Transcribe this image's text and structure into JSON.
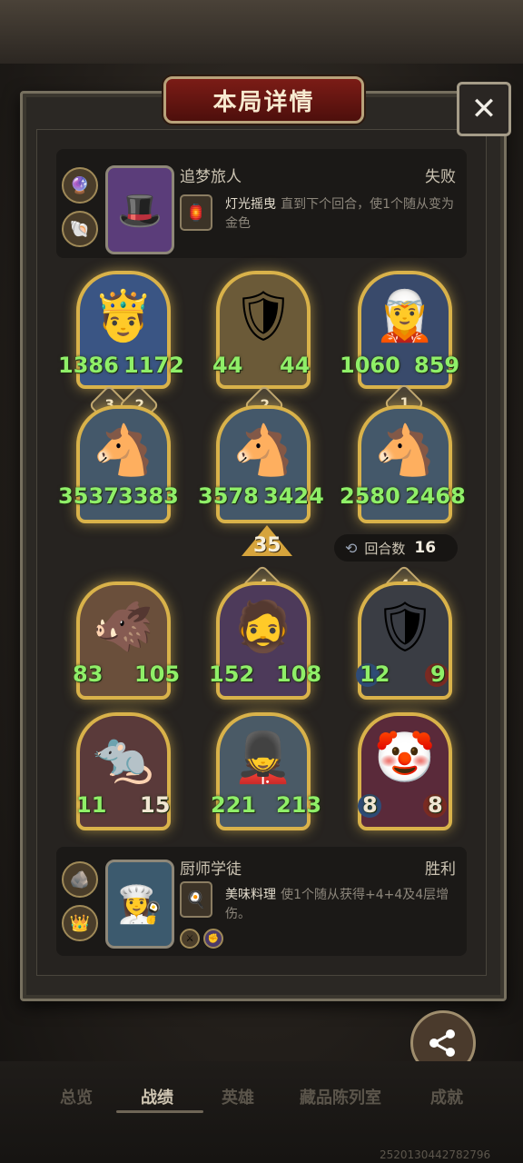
{
  "title": "本局详情",
  "close_icon": "close-icon",
  "opponent": {
    "name": "追梦旅人",
    "result": "失败",
    "skill_name": "灯光摇曳",
    "skill_desc": "直到下个回合，使1个随从变为金色"
  },
  "player": {
    "name": "厨师学徒",
    "result": "胜利",
    "skill_name": "美味料理",
    "skill_desc": "使1个随从获得+4+4及4层增伤。"
  },
  "opponent_units": [
    {
      "attack": "1386",
      "health": "1172",
      "stars": ""
    },
    {
      "attack": "44",
      "health": "44",
      "stars": ""
    },
    {
      "attack": "1060",
      "health": "859",
      "stars": ""
    },
    {
      "attack": "3537",
      "health": "3383",
      "stars": "3",
      "level": "2"
    },
    {
      "attack": "3578",
      "health": "3424",
      "stars": "",
      "level": "2"
    },
    {
      "attack": "2580",
      "health": "2468",
      "stars": "",
      "level": "1"
    }
  ],
  "damage": "35",
  "round": {
    "label": "回合数",
    "value": "16"
  },
  "player_units": [
    {
      "attack": "83",
      "health": "105",
      "level": ""
    },
    {
      "attack": "152",
      "health": "108",
      "level": "4"
    },
    {
      "attack": "12",
      "health": "9",
      "level": "4"
    },
    {
      "attack": "11",
      "health": "15",
      "level": ""
    },
    {
      "attack": "221",
      "health": "213",
      "level": ""
    },
    {
      "attack": "8",
      "health": "8",
      "level": ""
    }
  ],
  "share_label": "分享",
  "tabs": [
    "总览",
    "战绩",
    "英雄",
    "藏品陈列室",
    "成就"
  ],
  "footer_id": "2520130442782796"
}
